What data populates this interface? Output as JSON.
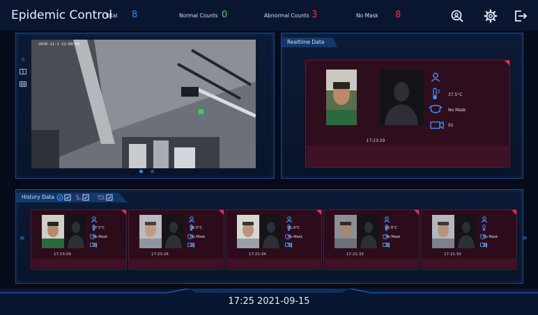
{
  "header": {
    "title": "Epidemic Control",
    "total_label": "Total",
    "total_value": "8",
    "normal_label": "Normal Counts",
    "normal_value": "0",
    "abnormal_label": "Abnormal Counts",
    "abnormal_value": "3",
    "nomask_label": "No Mask",
    "nomask_value": "8",
    "icons": [
      "face-search-icon",
      "settings-gear-icon",
      "logout-icon"
    ],
    "colors": {
      "total": "#2a8cf0",
      "normal": "#2ee052",
      "abnormal": "#ff2a3a",
      "nomask": "#ff2a3a"
    }
  },
  "live_view": {
    "timestamp": "2020-11-1 11:00:00"
  },
  "realtime": {
    "tab_label": "Realtime Data",
    "temperature": "37.5°C",
    "mask_status": "No Mask",
    "camera": "01",
    "time": "17:23:29"
  },
  "history": {
    "tab_label": "History Data",
    "items": [
      {
        "temperature": "37.5°C",
        "mask_status": "No Mask",
        "camera": "01",
        "time": "17:23:29"
      },
      {
        "temperature": "36.5°C",
        "mask_status": "No Mask",
        "camera": "01",
        "time": "17:23:26"
      },
      {
        "temperature": "41.6°C",
        "mask_status": "No Mask",
        "camera": "01",
        "time": "17:21:34"
      },
      {
        "temperature": "42.6°C",
        "mask_status": "No Mask",
        "camera": "01",
        "time": "17:21:33"
      },
      {
        "temperature": "",
        "mask_status": "No Mask",
        "camera": "01",
        "time": "17:21:33"
      }
    ],
    "prev_label": "«",
    "next_label": "»"
  },
  "footer": {
    "clock": "17:25  2021-09-15"
  }
}
